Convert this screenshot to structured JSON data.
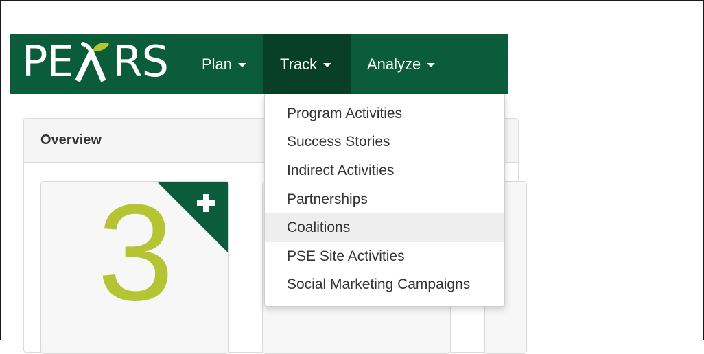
{
  "brand": {
    "logo_text_left": "PE",
    "logo_text_right": "RS",
    "colors": {
      "navbar": "#0b5c3b",
      "navbar_active": "#083f27",
      "accent_number": "#b5c432"
    }
  },
  "nav": {
    "items": [
      {
        "label": "Plan"
      },
      {
        "label": "Track"
      },
      {
        "label": "Analyze"
      }
    ]
  },
  "dropdown": {
    "items": [
      {
        "label": "Program Activities"
      },
      {
        "label": "Success Stories"
      },
      {
        "label": "Indirect Activities"
      },
      {
        "label": "Partnerships"
      },
      {
        "label": "Coalitions",
        "highlighted": true
      },
      {
        "label": "PSE Site Activities"
      },
      {
        "label": "Social Marketing Campaigns"
      }
    ]
  },
  "panel": {
    "title": "Overview"
  },
  "cards": [
    {
      "count": "3",
      "icon": "plus-icon"
    }
  ]
}
